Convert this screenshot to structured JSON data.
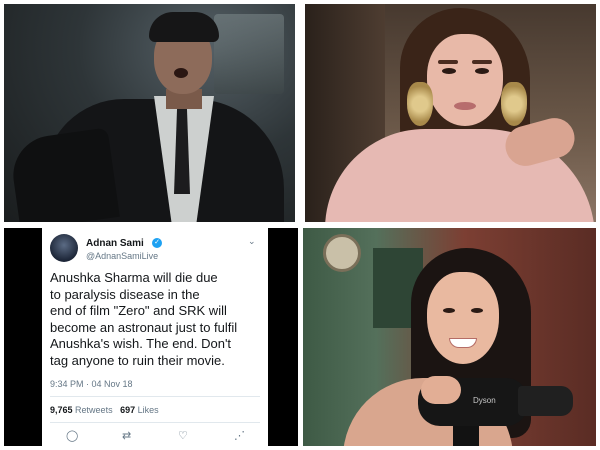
{
  "tweet": {
    "author_name": "Adnan Sami",
    "verified_mark": "✓",
    "handle": "@AdnanSamiLive",
    "menu_icon": "⌄",
    "text": "Anushka Sharma will die due\nto paralysis disease in the\nend of film \"Zero\" and SRK will\nbecome an astronaut just to fulfil\nAnushka's wish. The end. Don't\ntag anyone to ruin their movie.",
    "timestamp": "9:34 PM · 04 Nov 18",
    "retweets_count": "9,765",
    "retweets_label": "Retweets",
    "likes_count": "697",
    "likes_label": "Likes",
    "actions": {
      "reply_icon": "◯",
      "retweet_icon": "⇄",
      "like_icon": "♡",
      "share_icon": "⋰"
    }
  },
  "photos": {
    "dryer_brand": "Dyson"
  }
}
